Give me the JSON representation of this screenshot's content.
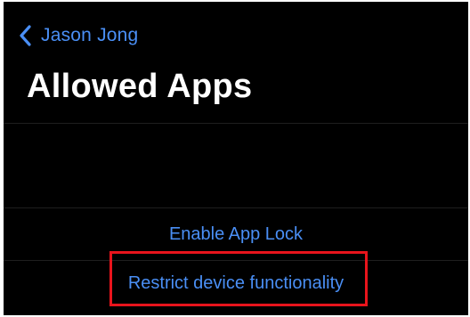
{
  "nav": {
    "back_label": "Jason Jong"
  },
  "page": {
    "title": "Allowed Apps"
  },
  "actions": {
    "enable_app_lock": "Enable App Lock",
    "restrict_device_functionality": "Restrict device functionality"
  },
  "colors": {
    "background": "#000000",
    "link": "#4a8ff5",
    "title": "#ffffff",
    "highlight": "#e8141c"
  },
  "icons": {
    "back": "chevron-left-icon"
  }
}
